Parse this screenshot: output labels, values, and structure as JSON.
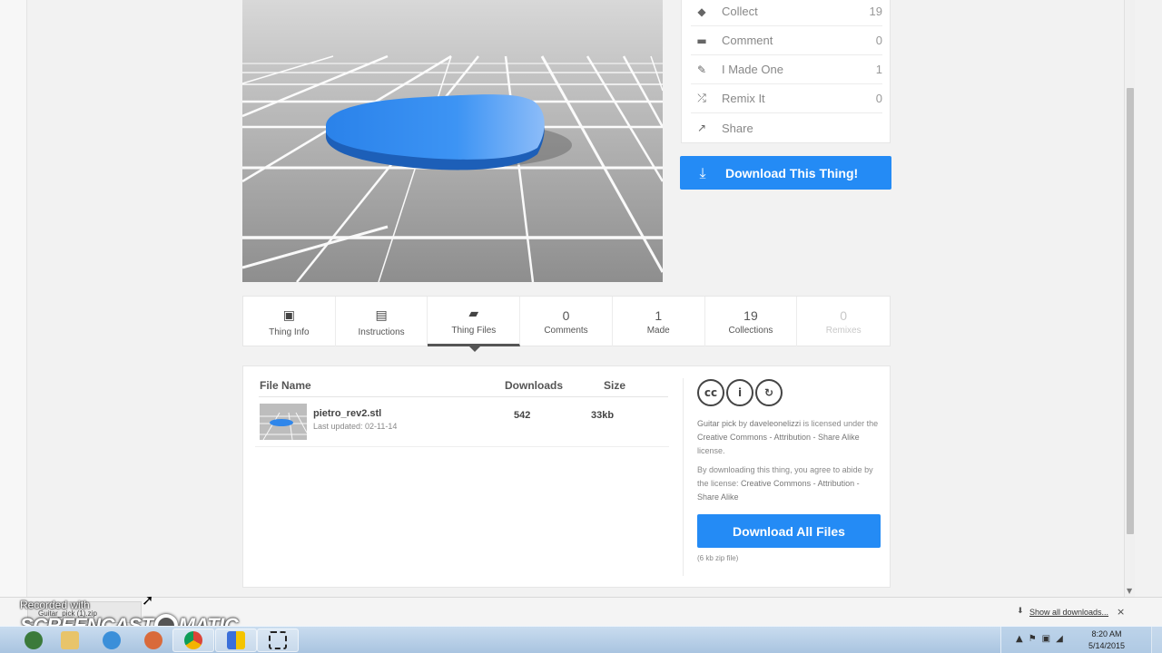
{
  "sidebar_actions": [
    {
      "icon": "collect-icon",
      "label": "Collect",
      "count": "19"
    },
    {
      "icon": "comment-icon",
      "label": "Comment",
      "count": "0"
    },
    {
      "icon": "made-one-icon",
      "label": "I Made One",
      "count": "1"
    },
    {
      "icon": "remix-icon",
      "label": "Remix It",
      "count": "0"
    },
    {
      "icon": "share-icon",
      "label": "Share",
      "count": ""
    }
  ],
  "download_thing_label": "Download This Thing!",
  "tabs": [
    {
      "label": "Thing Info",
      "icon": "thing-info-icon"
    },
    {
      "label": "Instructions",
      "icon": "instructions-icon"
    },
    {
      "label": "Thing Files",
      "icon": "thing-files-icon",
      "active": true
    },
    {
      "count": "0",
      "label": "Comments"
    },
    {
      "count": "1",
      "label": "Made"
    },
    {
      "count": "19",
      "label": "Collections"
    },
    {
      "count": "0",
      "label": "Remixes",
      "disabled": true
    }
  ],
  "files": {
    "headers": {
      "name": "File Name",
      "downloads": "Downloads",
      "size": "Size"
    },
    "rows": [
      {
        "name": "pietro_rev2.stl",
        "updated": "Last updated: 02-11-14",
        "downloads": "542",
        "size": "33kb"
      }
    ]
  },
  "license": {
    "thing_name": "Guitar pick",
    "by": "by",
    "author": "daveleonelizzi",
    "licensed_under": "is licensed under the",
    "license_name": "Creative Commons - Attribution - Share Alike",
    "license_suffix": "license.",
    "agree_prefix": "By downloading this thing, you agree to abide by the license:",
    "agree_license": "Creative Commons - Attribution - Share Alike",
    "download_all_label": "Download All Files",
    "zip_note": "(6 kb zip file)"
  },
  "download_bar": {
    "item_name": "Guitar_pick (1).zip",
    "show_all": "Show all downloads...",
    "close": "×"
  },
  "watermark": {
    "recorded_with": "Recorded with",
    "brand_left": "SCREENCAST",
    "brand_right": "MATIC"
  },
  "taskbar": {
    "time": "8:20 AM",
    "date": "5/14/2015"
  },
  "colors": {
    "accent_blue": "#248bf5",
    "model_blue": "#2f86ea"
  }
}
